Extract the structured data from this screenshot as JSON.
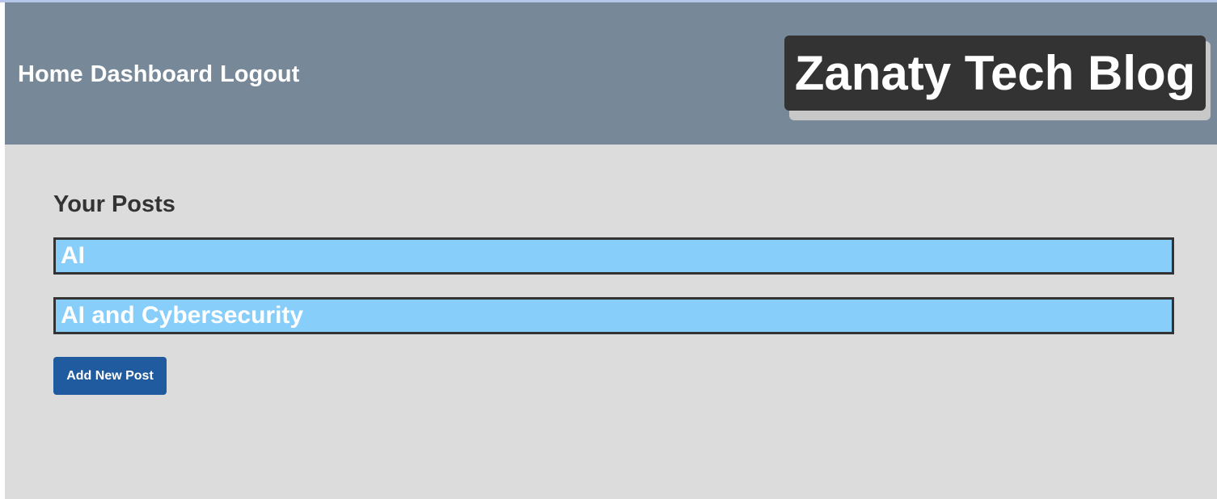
{
  "header": {
    "nav": [
      {
        "label": "Home"
      },
      {
        "label": "Dashboard"
      },
      {
        "label": "Logout"
      }
    ],
    "brand": "Zanaty Tech Blog"
  },
  "main": {
    "title": "Your Posts",
    "posts": [
      {
        "title": "AI"
      },
      {
        "title": "AI and Cybersecurity"
      }
    ],
    "add_button_label": "Add New Post"
  },
  "colors": {
    "header_bg": "#778899",
    "page_bg": "#dcdcdc",
    "brand_bg": "#333333",
    "post_bg": "#87cefa",
    "button_bg": "#215b9f"
  }
}
